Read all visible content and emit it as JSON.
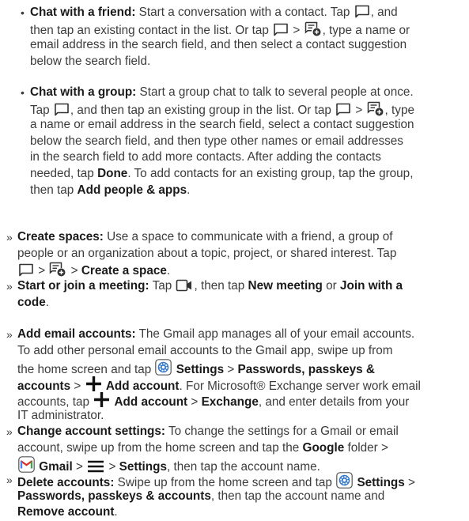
{
  "items": [
    {
      "marker": "•",
      "lines": [
        [
          {
            "b": "Chat with a friend:"
          },
          {
            "t": " Start a conversation with a contact. Tap "
          },
          {
            "i": "chat-icon"
          },
          {
            "t": ", and"
          }
        ],
        [
          {
            "t": "then tap an existing contact in the list. Or tap "
          },
          {
            "i": "chat-icon"
          },
          {
            "t": " > "
          },
          {
            "i": "new-chat-icon"
          },
          {
            "t": ", type a name or"
          }
        ],
        [
          {
            "t": "email address in the search field, and then select a contact suggestion"
          }
        ],
        [
          {
            "t": "below the search field."
          }
        ]
      ]
    },
    {
      "marker": "•",
      "lines": [
        [
          {
            "b": "Chat with a group:"
          },
          {
            "t": " Start a group chat to talk to several people at once."
          }
        ],
        [
          {
            "t": "Tap "
          },
          {
            "i": "chat-icon"
          },
          {
            "t": ", and then tap an existing group in the list. Or tap "
          },
          {
            "i": "chat-icon"
          },
          {
            "t": " > "
          },
          {
            "i": "new-chat-icon"
          },
          {
            "t": ", type"
          }
        ],
        [
          {
            "t": "a name or email address in the search field, select a contact suggestion"
          }
        ],
        [
          {
            "t": "below the search field, and then type other names or email addresses"
          }
        ],
        [
          {
            "t": "in the search field to add more contacts. After adding the contacts"
          }
        ],
        [
          {
            "t": "needed, tap "
          },
          {
            "b": "Done"
          },
          {
            "t": ". To add contacts for an existing group, tap the group,"
          }
        ],
        [
          {
            "t": "then tap "
          },
          {
            "b": "Add people & apps"
          },
          {
            "t": "."
          }
        ]
      ]
    },
    {
      "marker": "»",
      "lines": [
        [
          {
            "b": "Create spaces:"
          },
          {
            "t": " Use a space to communicate with a friend, a group of"
          }
        ],
        [
          {
            "t": "people or an organization about a topic, project, or shared interest. Tap"
          }
        ],
        [
          {
            "i": "chat-icon"
          },
          {
            "t": " > "
          },
          {
            "i": "new-chat-icon"
          },
          {
            "t": " > "
          },
          {
            "b": "Create a space"
          },
          {
            "t": "."
          }
        ]
      ]
    },
    {
      "marker": "»",
      "lines": [
        [
          {
            "b": "Start or join a meeting:"
          },
          {
            "t": " Tap "
          },
          {
            "i": "video-icon"
          },
          {
            "t": ", then tap "
          },
          {
            "b": "New meeting"
          },
          {
            "t": " or "
          },
          {
            "b": "Join with a"
          }
        ],
        [
          {
            "b": "code"
          },
          {
            "t": "."
          }
        ]
      ]
    },
    {
      "marker": "»",
      "lines": [
        [
          {
            "b": "Add email accounts:"
          },
          {
            "t": " The Gmail app manages all of your email accounts."
          }
        ],
        [
          {
            "t": "To add other personal email accounts to the Gmail app, swipe up from"
          }
        ],
        [
          {
            "t": "the home screen and tap "
          },
          {
            "i": "settings-icon"
          },
          {
            "t": " "
          },
          {
            "b": "Settings"
          },
          {
            "t": " > "
          },
          {
            "b": "Passwords, passkeys &"
          }
        ],
        [
          {
            "b": "accounts"
          },
          {
            "t": " > "
          },
          {
            "i": "plus-icon"
          },
          {
            "t": " "
          },
          {
            "b": "Add account"
          },
          {
            "t": ". For Microsoft® Exchange server work email"
          }
        ],
        [
          {
            "t": "accounts, tap "
          },
          {
            "i": "plus-icon"
          },
          {
            "t": " "
          },
          {
            "b": "Add account"
          },
          {
            "t": " > "
          },
          {
            "b": "Exchange"
          },
          {
            "t": ", and enter details from your"
          }
        ],
        [
          {
            "t": "IT administrator."
          }
        ]
      ]
    },
    {
      "marker": "»",
      "lines": [
        [
          {
            "b": "Change account settings:"
          },
          {
            "t": " To change the settings for a Gmail or email"
          }
        ],
        [
          {
            "t": "account, swipe up from the home screen and tap the "
          },
          {
            "b": "Google"
          },
          {
            "t": " folder >"
          }
        ],
        [
          {
            "i": "gmail-icon"
          },
          {
            "t": " "
          },
          {
            "b": "Gmail"
          },
          {
            "t": " > "
          },
          {
            "i": "menu-icon"
          },
          {
            "t": " > "
          },
          {
            "b": "Settings"
          },
          {
            "t": ", then tap the account name."
          }
        ]
      ]
    },
    {
      "marker": "»",
      "lines": [
        [
          {
            "b": "Delete accounts:"
          },
          {
            "t": " Swipe up from the home screen and tap "
          },
          {
            "i": "settings-icon"
          },
          {
            "t": " "
          },
          {
            "b": "Settings"
          },
          {
            "t": " >"
          }
        ],
        [
          {
            "b": "Passwords, passkeys & accounts"
          },
          {
            "t": ", then tap the account name and"
          }
        ],
        [
          {
            "b": "Remove account"
          },
          {
            "t": "."
          }
        ]
      ]
    }
  ]
}
